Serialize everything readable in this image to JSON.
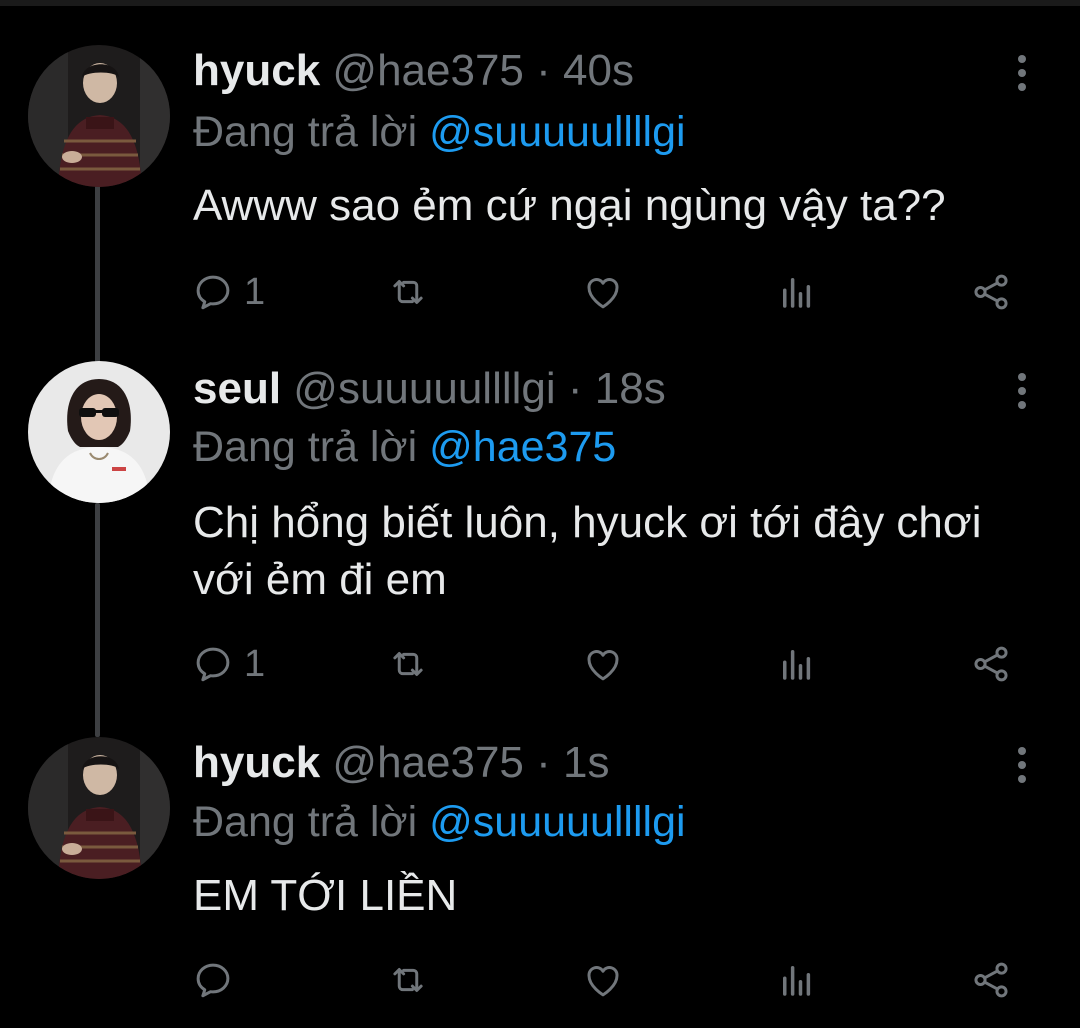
{
  "tweets": [
    {
      "name": "hyuck",
      "handle": "@hae375",
      "time": "· 40s",
      "replying_label": "Đang trả lời",
      "replying_to": "@suuuuullllgi",
      "text": "Awww sao ẻm cứ ngại ngùng vậy ta??",
      "reply_count": "1",
      "avatar": "man-in-sweater"
    },
    {
      "name": "seul",
      "handle": "@suuuuullllgi",
      "time": "· 18s",
      "replying_label": "Đang trả lời",
      "replying_to": "@hae375",
      "text": "Chị hổng biết luôn, hyuck ơi tới đây chơi với ẻm đi em",
      "reply_count": "1",
      "avatar": "woman-sunglasses"
    },
    {
      "name": "hyuck",
      "handle": "@hae375",
      "time": "· 1s",
      "replying_label": "Đang trả lời",
      "replying_to": "@suuuuullllgi",
      "text": "EM TỚI LIỀN",
      "reply_count": "",
      "avatar": "man-in-sweater"
    }
  ],
  "colors": {
    "background": "#000000",
    "muted": "#71767b",
    "link": "#1d9bf0",
    "thread": "#3d3f42"
  },
  "icons": [
    "reply-icon",
    "retweet-icon",
    "like-icon",
    "analytics-icon",
    "share-icon",
    "more-icon"
  ]
}
